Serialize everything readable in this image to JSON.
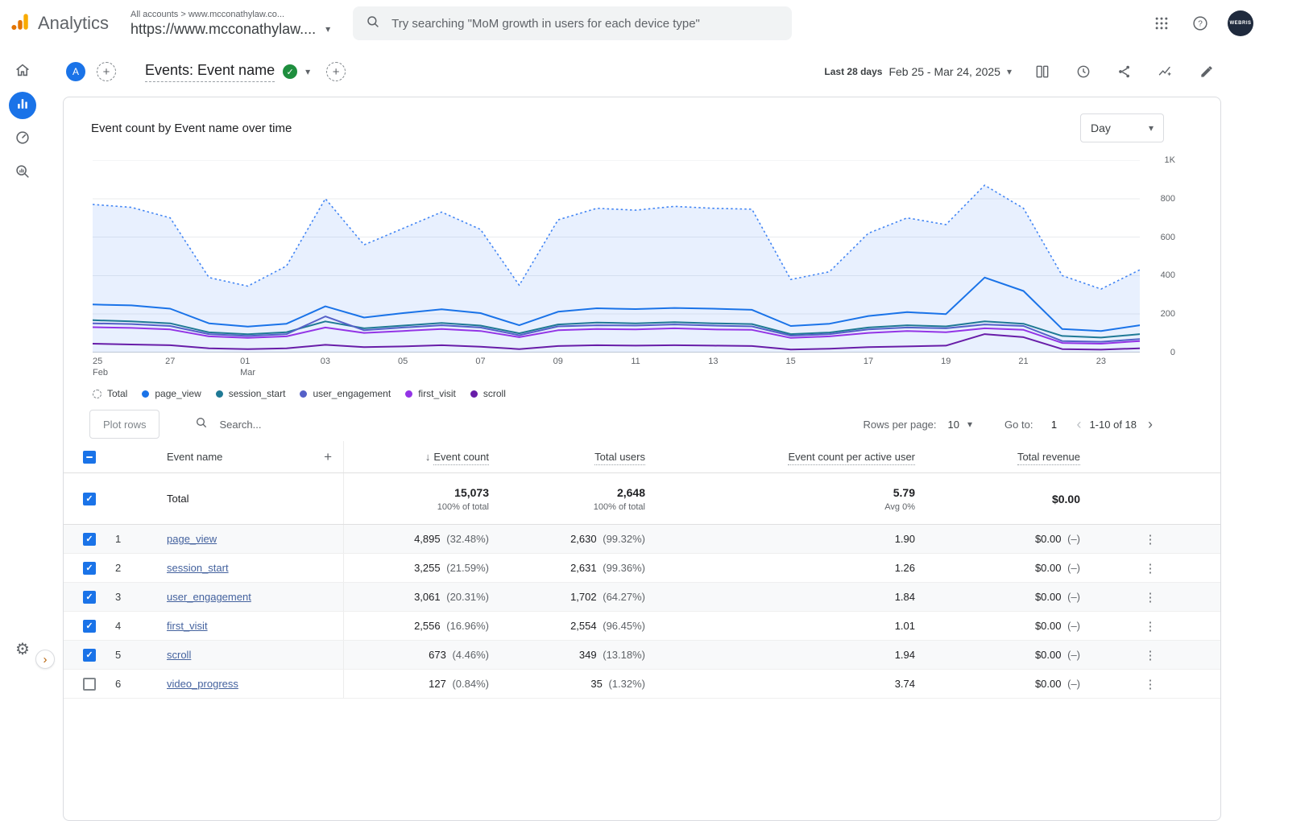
{
  "topbar": {
    "product": "Analytics",
    "breadcrumb": "All accounts > www.mcconathylaw.co...",
    "property": "https://www.mcconathylaw....",
    "search_placeholder": "Try searching \"MoM growth in users for each device type\"",
    "avatar_label": "WEBRIS"
  },
  "report_header": {
    "account_badge": "A",
    "title": "Events: Event name",
    "date_preset": "Last 28 days",
    "date_range": "Feb 25 - Mar 24, 2025"
  },
  "chart_card": {
    "title": "Event count by Event name over time",
    "granularity": "Day"
  },
  "chart_data": {
    "type": "line",
    "title": "Event count by Event name over time",
    "x": [
      "Feb 25",
      "Feb 26",
      "Feb 27",
      "Feb 28",
      "Mar 01",
      "Mar 02",
      "Mar 03",
      "Mar 04",
      "Mar 05",
      "Mar 06",
      "Mar 07",
      "Mar 08",
      "Mar 09",
      "Mar 10",
      "Mar 11",
      "Mar 12",
      "Mar 13",
      "Mar 14",
      "Mar 15",
      "Mar 16",
      "Mar 17",
      "Mar 18",
      "Mar 19",
      "Mar 20",
      "Mar 21",
      "Mar 22",
      "Mar 23",
      "Mar 24"
    ],
    "x_ticks": [
      {
        "i": 0,
        "lines": [
          "25",
          "Feb"
        ]
      },
      {
        "i": 2,
        "lines": [
          "27"
        ]
      },
      {
        "i": 4,
        "lines": [
          "01",
          "Mar"
        ]
      },
      {
        "i": 6,
        "lines": [
          "03"
        ]
      },
      {
        "i": 8,
        "lines": [
          "05"
        ]
      },
      {
        "i": 10,
        "lines": [
          "07"
        ]
      },
      {
        "i": 12,
        "lines": [
          "09"
        ]
      },
      {
        "i": 14,
        "lines": [
          "11"
        ]
      },
      {
        "i": 16,
        "lines": [
          "13"
        ]
      },
      {
        "i": 18,
        "lines": [
          "15"
        ]
      },
      {
        "i": 20,
        "lines": [
          "17"
        ]
      },
      {
        "i": 22,
        "lines": [
          "19"
        ]
      },
      {
        "i": 24,
        "lines": [
          "21"
        ]
      },
      {
        "i": 26,
        "lines": [
          "23"
        ]
      }
    ],
    "ylim": [
      0,
      1000
    ],
    "yticks": [
      0,
      200,
      400,
      600,
      800,
      1000
    ],
    "ytick_labels": [
      "0",
      "200",
      "400",
      "600",
      "800",
      "1K"
    ],
    "area_fill": "rgba(66,133,244,0.12)",
    "legend_position": "bottom",
    "grid": true,
    "series": [
      {
        "name": "Total",
        "color": "#4285f4",
        "style": "dotted-area",
        "values": [
          770,
          755,
          700,
          390,
          345,
          450,
          800,
          560,
          645,
          730,
          640,
          350,
          690,
          750,
          740,
          760,
          750,
          745,
          380,
          420,
          620,
          700,
          665,
          870,
          750,
          400,
          330,
          430
        ]
      },
      {
        "name": "page_view",
        "color": "#1a73e8",
        "values": [
          250,
          245,
          228,
          152,
          135,
          150,
          240,
          182,
          205,
          225,
          205,
          142,
          212,
          230,
          226,
          232,
          228,
          222,
          138,
          150,
          190,
          210,
          200,
          390,
          320,
          122,
          112,
          142
        ]
      },
      {
        "name": "session_start",
        "color": "#1f7995",
        "values": [
          168,
          162,
          152,
          105,
          95,
          106,
          162,
          126,
          140,
          154,
          140,
          100,
          146,
          156,
          152,
          158,
          152,
          148,
          96,
          104,
          130,
          142,
          136,
          162,
          150,
          86,
          78,
          96
        ]
      },
      {
        "name": "user_engagement",
        "color": "#5560c8",
        "values": [
          152,
          148,
          138,
          96,
          86,
          96,
          188,
          116,
          130,
          142,
          130,
          90,
          136,
          142,
          140,
          146,
          140,
          136,
          88,
          96,
          120,
          130,
          126,
          146,
          138,
          60,
          56,
          70
        ]
      },
      {
        "name": "first_visit",
        "color": "#9334e6",
        "values": [
          132,
          128,
          120,
          84,
          76,
          84,
          130,
          102,
          112,
          122,
          112,
          80,
          116,
          122,
          120,
          126,
          120,
          118,
          76,
          84,
          102,
          112,
          106,
          126,
          118,
          50,
          46,
          60
        ]
      },
      {
        "name": "scroll",
        "color": "#681da8",
        "values": [
          46,
          42,
          38,
          22,
          18,
          22,
          40,
          28,
          32,
          38,
          30,
          18,
          34,
          38,
          36,
          38,
          36,
          34,
          16,
          20,
          28,
          32,
          36,
          96,
          80,
          18,
          15,
          22
        ]
      }
    ]
  },
  "table": {
    "plot_rows_label": "Plot rows",
    "search_placeholder": "Search...",
    "rows_per_page_label": "Rows per page:",
    "rows_per_page_value": "10",
    "goto_label": "Go to:",
    "goto_value": "1",
    "page_range": "1-10 of 18",
    "columns": {
      "name": "Event name",
      "event_count": "Event count",
      "total_users": "Total users",
      "per_active_user": "Event count per active user",
      "total_revenue": "Total revenue"
    },
    "totals": {
      "label": "Total",
      "event_count": "15,073",
      "event_count_sub": "100% of total",
      "total_users": "2,648",
      "total_users_sub": "100% of total",
      "per_active_user": "5.79",
      "per_active_user_sub": "Avg 0%",
      "total_revenue": "$0.00"
    },
    "rows": [
      {
        "index": "1",
        "name": "page_view",
        "checked": true,
        "event_count": "4,895",
        "event_count_pct": "(32.48%)",
        "total_users": "2,630",
        "total_users_pct": "(99.32%)",
        "per_active_user": "1.90",
        "total_revenue": "$0.00",
        "total_revenue_note": "(–)"
      },
      {
        "index": "2",
        "name": "session_start",
        "checked": true,
        "event_count": "3,255",
        "event_count_pct": "(21.59%)",
        "total_users": "2,631",
        "total_users_pct": "(99.36%)",
        "per_active_user": "1.26",
        "total_revenue": "$0.00",
        "total_revenue_note": "(–)"
      },
      {
        "index": "3",
        "name": "user_engagement",
        "checked": true,
        "event_count": "3,061",
        "event_count_pct": "(20.31%)",
        "total_users": "1,702",
        "total_users_pct": "(64.27%)",
        "per_active_user": "1.84",
        "total_revenue": "$0.00",
        "total_revenue_note": "(–)"
      },
      {
        "index": "4",
        "name": "first_visit",
        "checked": true,
        "event_count": "2,556",
        "event_count_pct": "(16.96%)",
        "total_users": "2,554",
        "total_users_pct": "(96.45%)",
        "per_active_user": "1.01",
        "total_revenue": "$0.00",
        "total_revenue_note": "(–)"
      },
      {
        "index": "5",
        "name": "scroll",
        "checked": true,
        "event_count": "673",
        "event_count_pct": "(4.46%)",
        "total_users": "349",
        "total_users_pct": "(13.18%)",
        "per_active_user": "1.94",
        "total_revenue": "$0.00",
        "total_revenue_note": "(–)"
      },
      {
        "index": "6",
        "name": "video_progress",
        "checked": false,
        "event_count": "127",
        "event_count_pct": "(0.84%)",
        "total_users": "35",
        "total_users_pct": "(1.32%)",
        "per_active_user": "3.74",
        "total_revenue": "$0.00",
        "total_revenue_note": "(–)"
      }
    ]
  },
  "icons": {
    "caret_down": "▾",
    "gear": "⚙",
    "ellipsis": "⋮",
    "chevron_left": "‹",
    "chevron_right": "›",
    "plus": "+",
    "check": "✓",
    "sort_desc": "↓",
    "expand": "›",
    "help": "?"
  }
}
